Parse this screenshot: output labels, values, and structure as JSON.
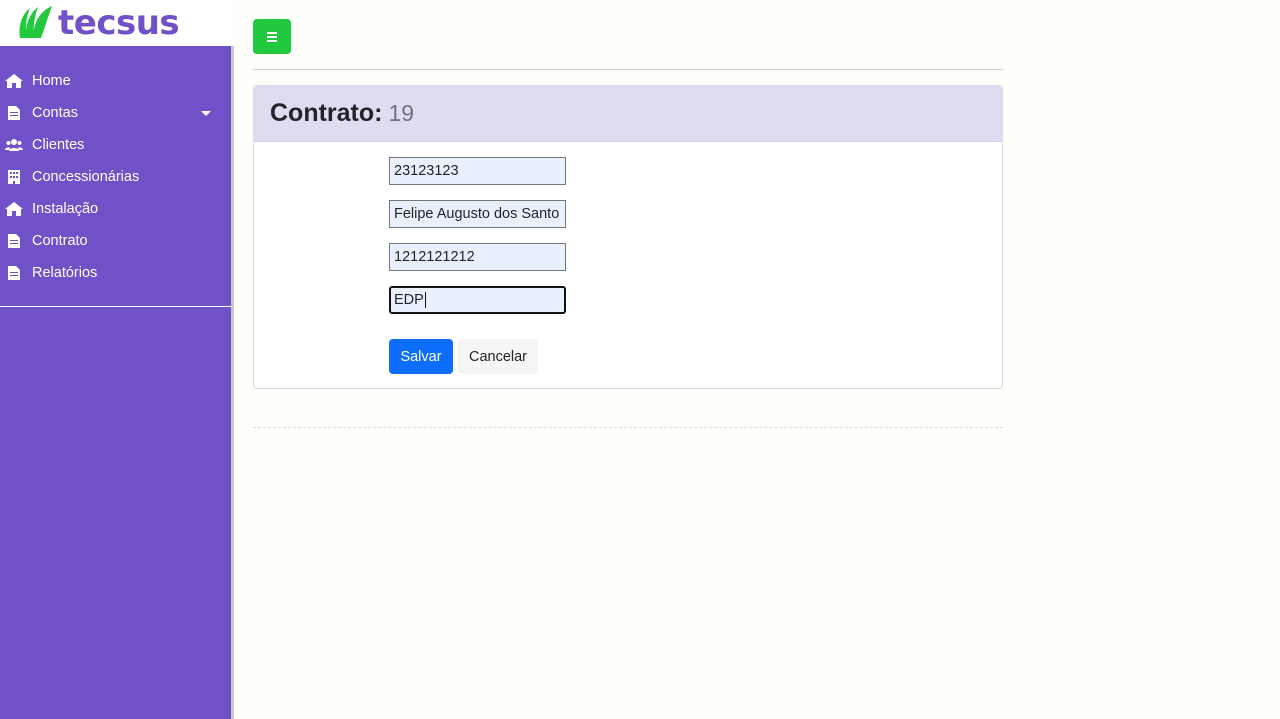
{
  "brand": {
    "name": "tecsus",
    "primary_color": "#7051c7",
    "accent_color": "#22c93e"
  },
  "sidebar": {
    "items": [
      {
        "label": "Home",
        "icon": "home-icon"
      },
      {
        "label": "Contas",
        "icon": "file-icon",
        "has_dropdown": true
      },
      {
        "label": "Clientes",
        "icon": "users-icon"
      },
      {
        "label": "Concessionárias",
        "icon": "building-icon"
      },
      {
        "label": "Instalação",
        "icon": "home-icon"
      },
      {
        "label": "Contrato",
        "icon": "file-icon"
      },
      {
        "label": "Relatórios",
        "icon": "file-icon"
      }
    ]
  },
  "header": {
    "menu_icon": "hamburger-icon"
  },
  "card": {
    "title": "Contrato:",
    "id": "19"
  },
  "form": {
    "fields": [
      {
        "value": "23123123"
      },
      {
        "value": "Felipe Augusto dos Santo"
      },
      {
        "value": "1212121212"
      },
      {
        "value": "EDP",
        "focused": true
      }
    ],
    "save_label": "Salvar",
    "cancel_label": "Cancelar"
  }
}
